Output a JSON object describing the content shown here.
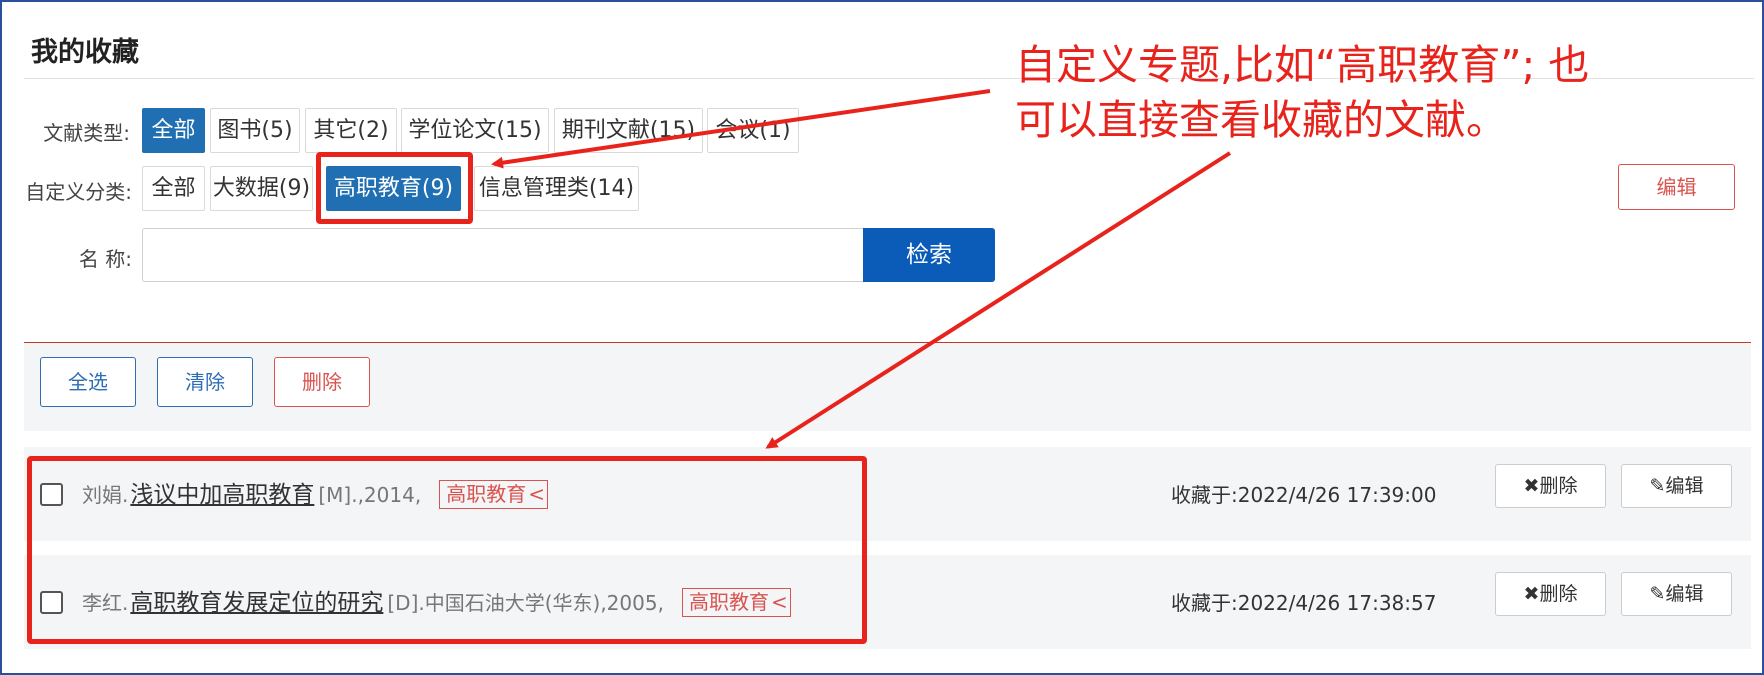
{
  "page_title": "我的收藏",
  "filters": {
    "doc_type_label": "文献类型:",
    "doc_types": [
      "全部",
      "图书(5)",
      "其它(2)",
      "学位论文(15)",
      "期刊文献(15)",
      "会议(1)"
    ],
    "custom_label": "自定义分类:",
    "custom_categories": [
      "全部",
      "大数据(9)",
      "高职教育(9)",
      "信息管理类(14)"
    ],
    "name_label": "名 称:",
    "search_button": "检索",
    "edit_button": "编辑"
  },
  "toolbar": {
    "select_all": "全选",
    "clear": "清除",
    "delete": "删除"
  },
  "items": [
    {
      "author": "刘娟.",
      "title": "浅议中加高职教育",
      "meta": "[M].,2014,",
      "tag": "高职教育",
      "date": "收藏于:2022/4/26 17:39:00",
      "delete_label": "✖删除",
      "edit_label": "✎编辑"
    },
    {
      "author": "李红.",
      "title": "高职教育发展定位的研究",
      "meta": "[D].中国石油大学(华东),2005,",
      "tag": "高职教育",
      "date": "收藏于:2022/4/26 17:38:57",
      "delete_label": "✖删除",
      "edit_label": "✎编辑"
    }
  ],
  "annotation": {
    "line1": "自定义专题,比如“高职教育”; 也",
    "line2": "可以直接查看收藏的文献。",
    "color": "#e8231c"
  },
  "colors": {
    "active_chip": "#1f6fb2",
    "search_button": "#0a5cb8",
    "danger": "#d9534f"
  }
}
